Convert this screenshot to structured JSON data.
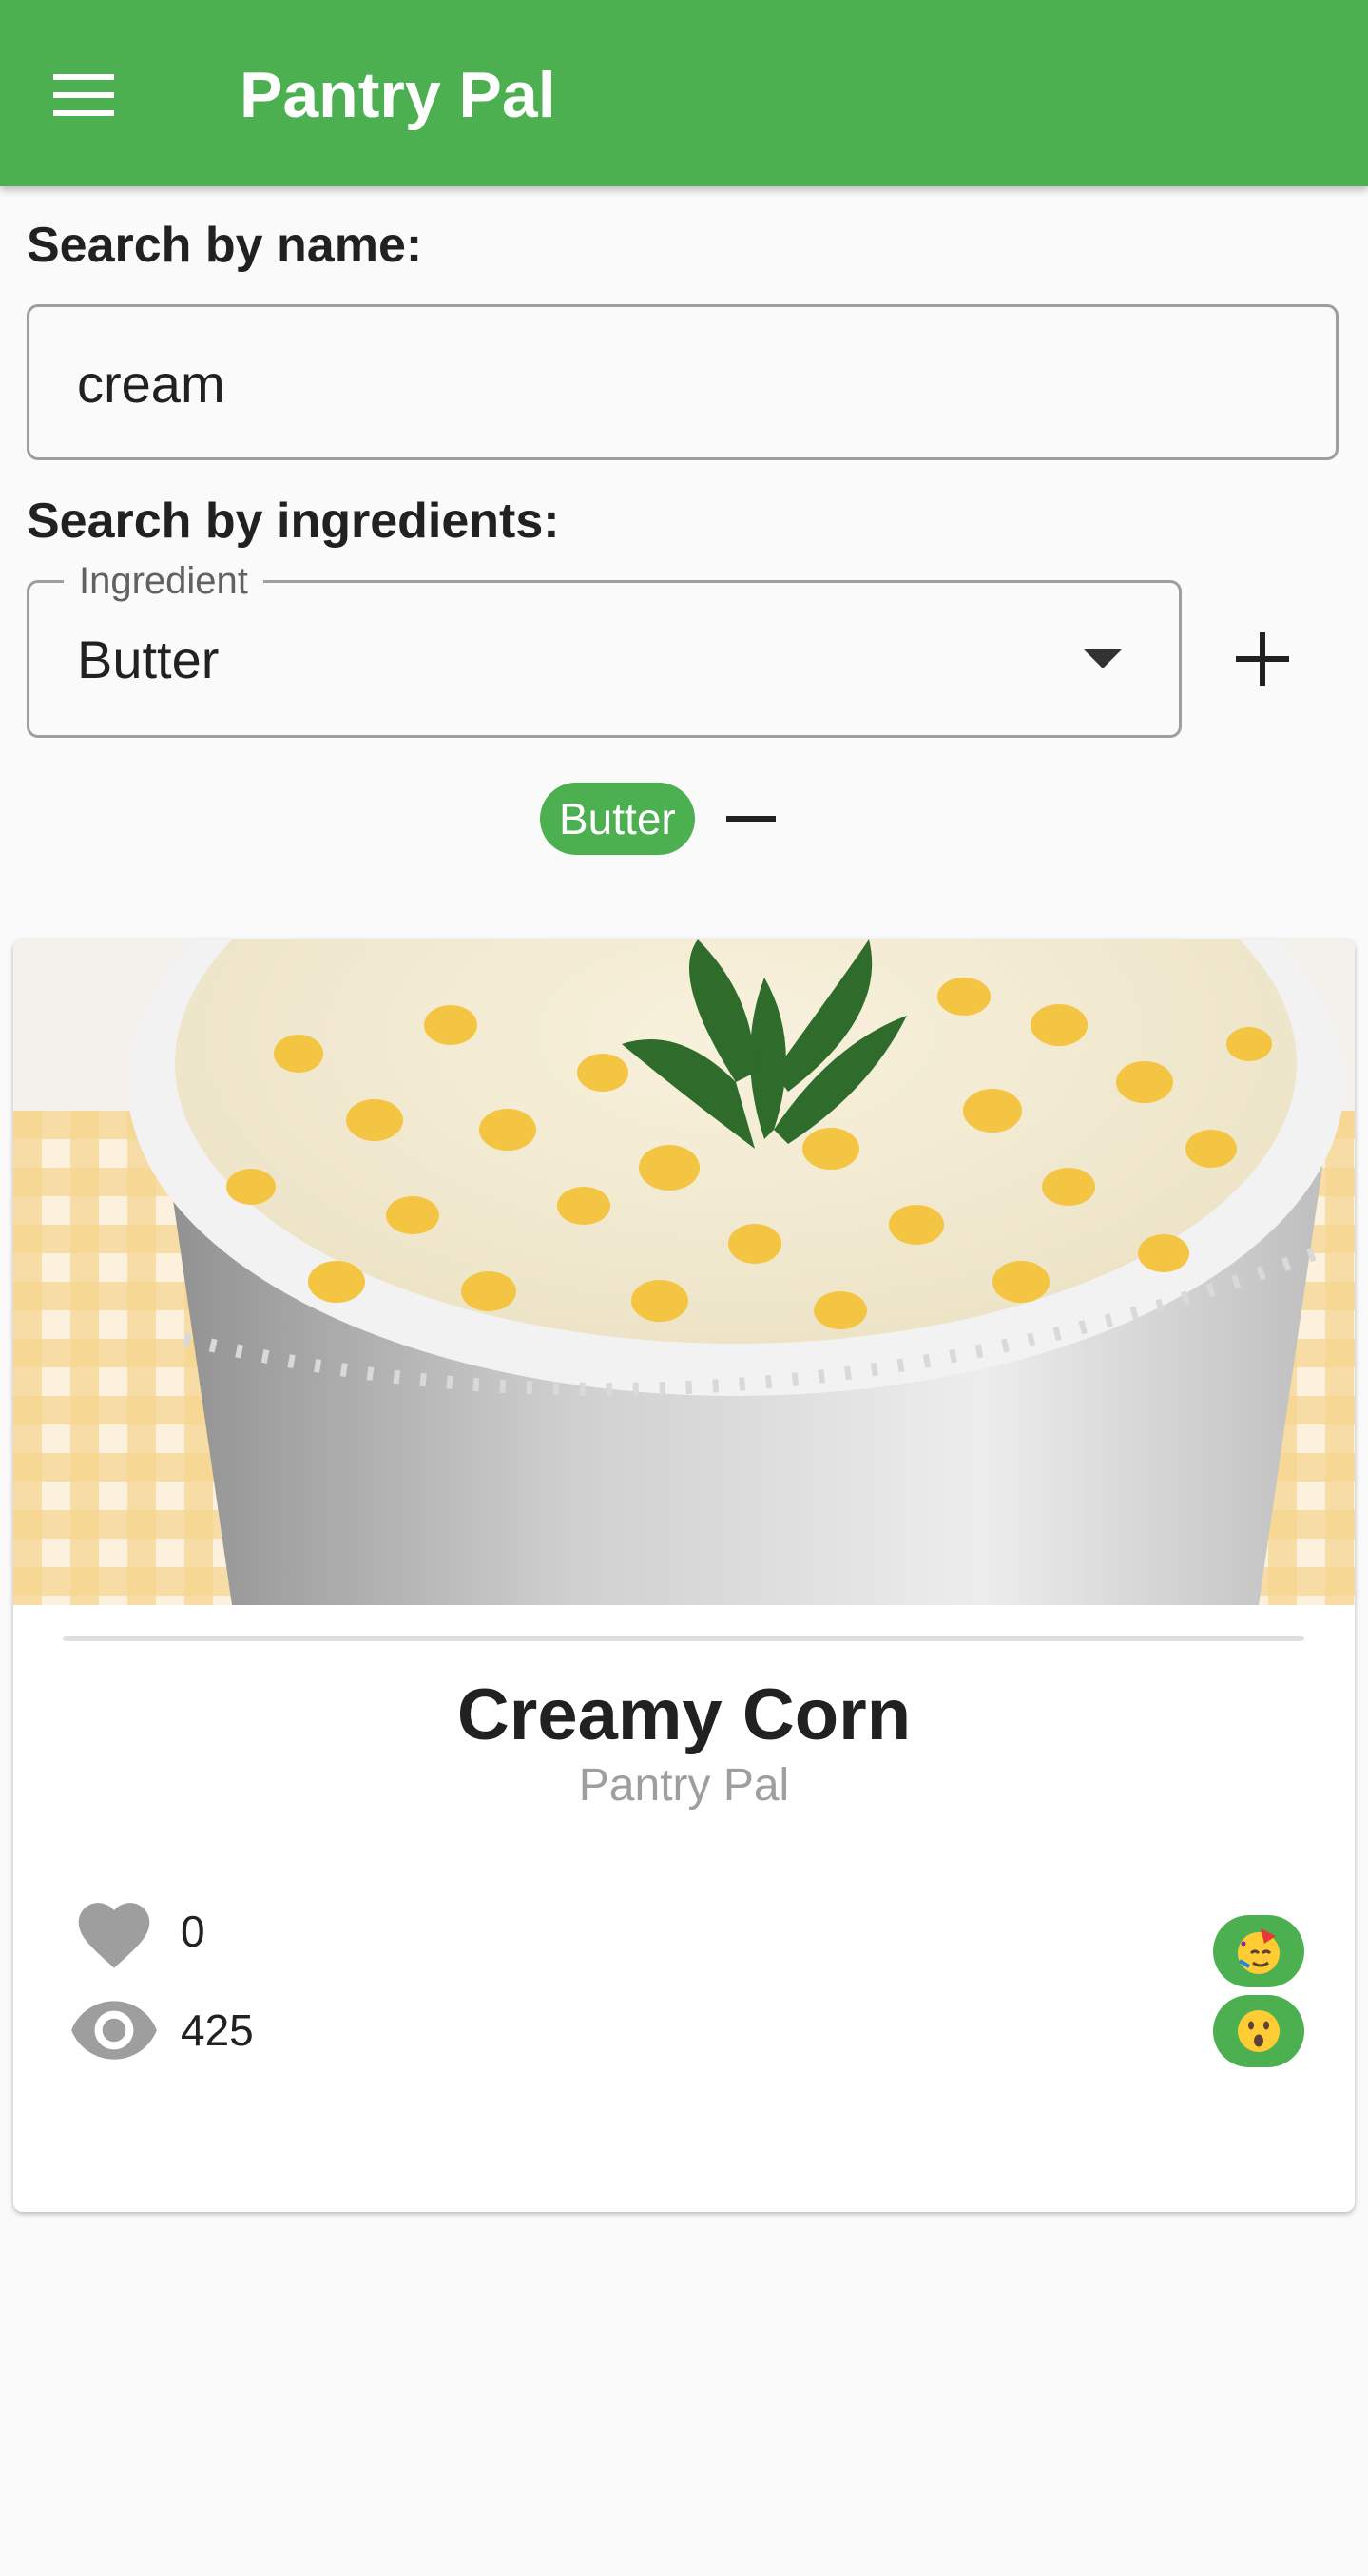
{
  "app": {
    "title": "Pantry Pal"
  },
  "search": {
    "name_label": "Search by name:",
    "name_value": "cream",
    "ingredients_label": "Search by ingredients:",
    "ingredient_field_label": "Ingredient",
    "ingredient_selected": "Butter",
    "selected_ingredients": [
      "Butter"
    ]
  },
  "recipe": {
    "title": "Creamy Corn",
    "author": "Pantry Pal",
    "likes": "0",
    "views": "425",
    "reactions": [
      "party-face-icon",
      "surprised-face-icon"
    ]
  },
  "colors": {
    "primary": "#4caf50",
    "background": "#fafafa",
    "icon_gray": "#9e9e9e"
  }
}
